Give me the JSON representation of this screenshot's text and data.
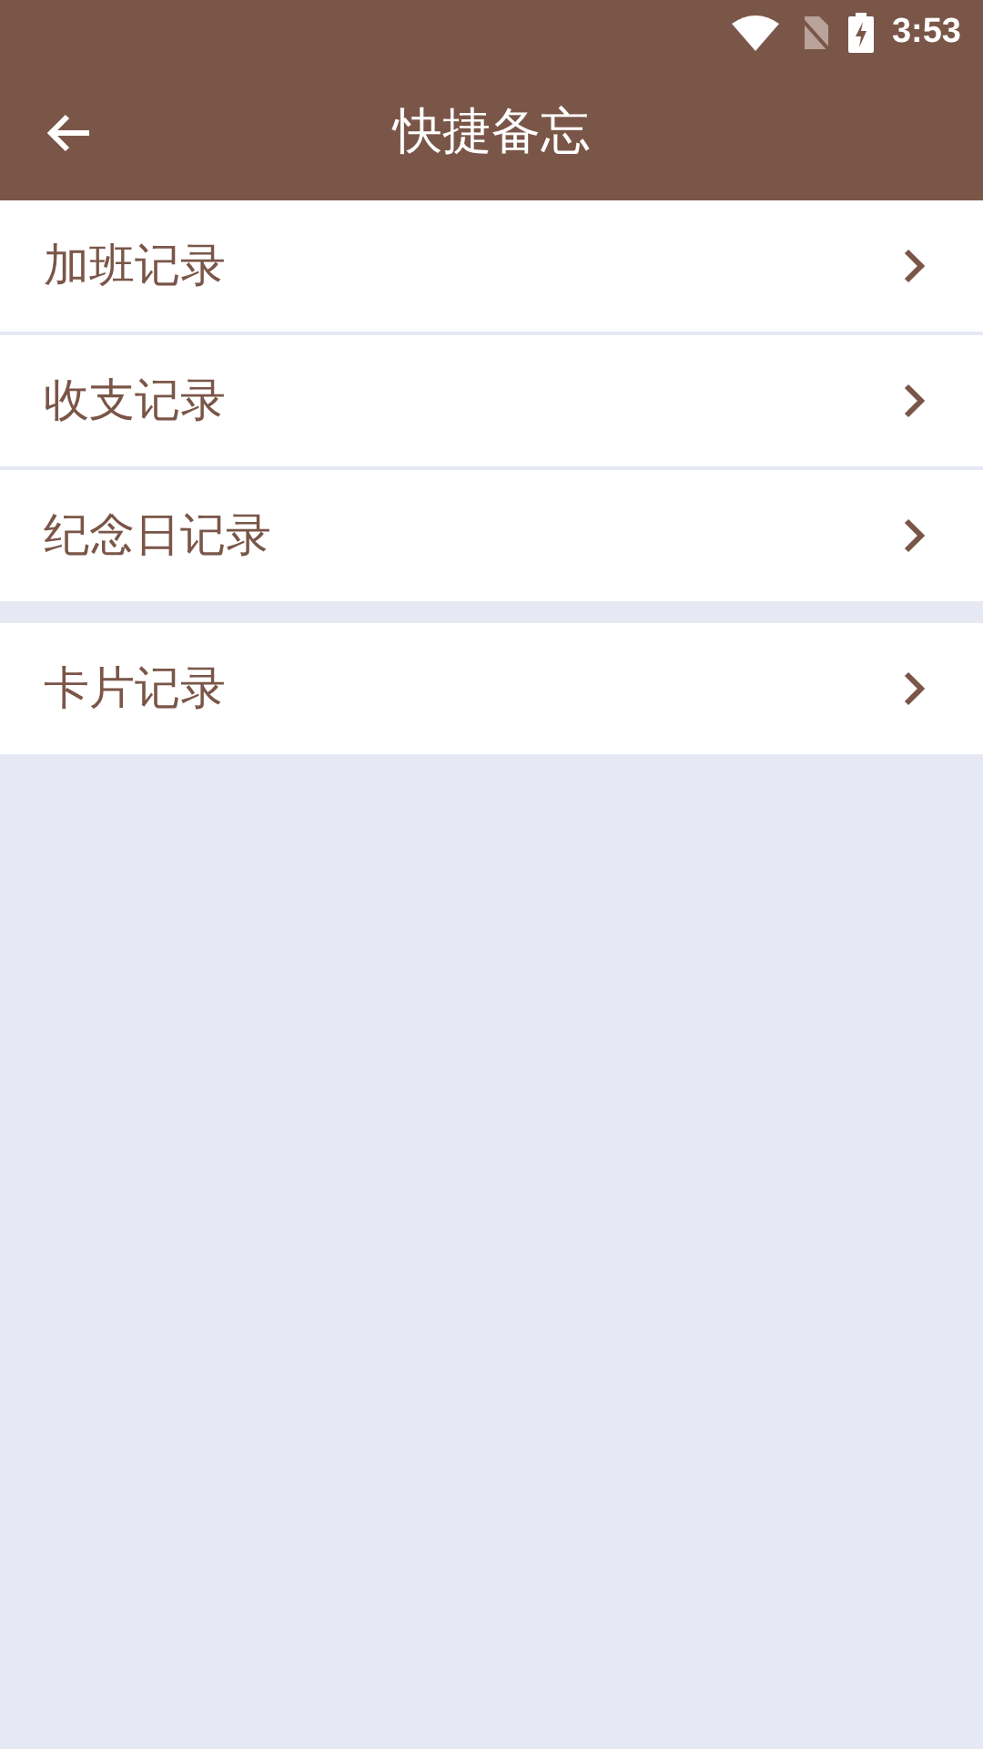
{
  "status_bar": {
    "time": "3:53"
  },
  "app_bar": {
    "title": "快捷备忘"
  },
  "groups": [
    {
      "items": [
        {
          "label": "加班记录"
        },
        {
          "label": "收支记录"
        },
        {
          "label": "纪念日记录"
        }
      ]
    },
    {
      "items": [
        {
          "label": "卡片记录"
        }
      ]
    }
  ]
}
